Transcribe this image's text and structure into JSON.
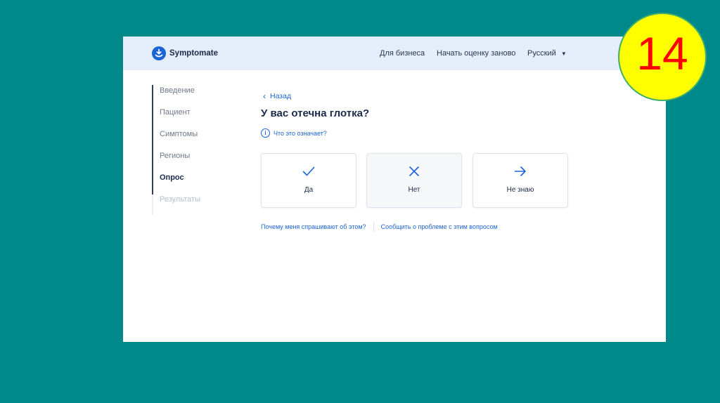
{
  "app": {
    "name": "Symptomate"
  },
  "header": {
    "nav": [
      {
        "label": "Для бизнеса"
      },
      {
        "label": "Начать оценку заново"
      }
    ],
    "language": "Русский"
  },
  "steps": [
    {
      "label": "Введение",
      "state": "done"
    },
    {
      "label": "Пациент",
      "state": "done"
    },
    {
      "label": "Симптомы",
      "state": "done"
    },
    {
      "label": "Регионы",
      "state": "done"
    },
    {
      "label": "Опрос",
      "state": "active"
    },
    {
      "label": "Результаты",
      "state": "future"
    }
  ],
  "back_label": "Назад",
  "question": "У вас отечна глотка?",
  "explain_label": "Что это означает?",
  "answers": [
    {
      "label": "Да",
      "icon": "check-icon"
    },
    {
      "label": "Нет",
      "icon": "x-icon"
    },
    {
      "label": "Не знаю",
      "icon": "arrow-right-icon"
    }
  ],
  "footer_links": [
    {
      "label": "Почему меня спрашивают об этом?"
    },
    {
      "label": "Сообщить о проблеме с этим вопросом"
    }
  ],
  "slide_number": "14",
  "colors": {
    "background": "#00898a",
    "header_bg": "#e3eefa",
    "accent": "#1a64d8",
    "badge_fill": "#ffff00",
    "badge_text": "#ff0000"
  }
}
